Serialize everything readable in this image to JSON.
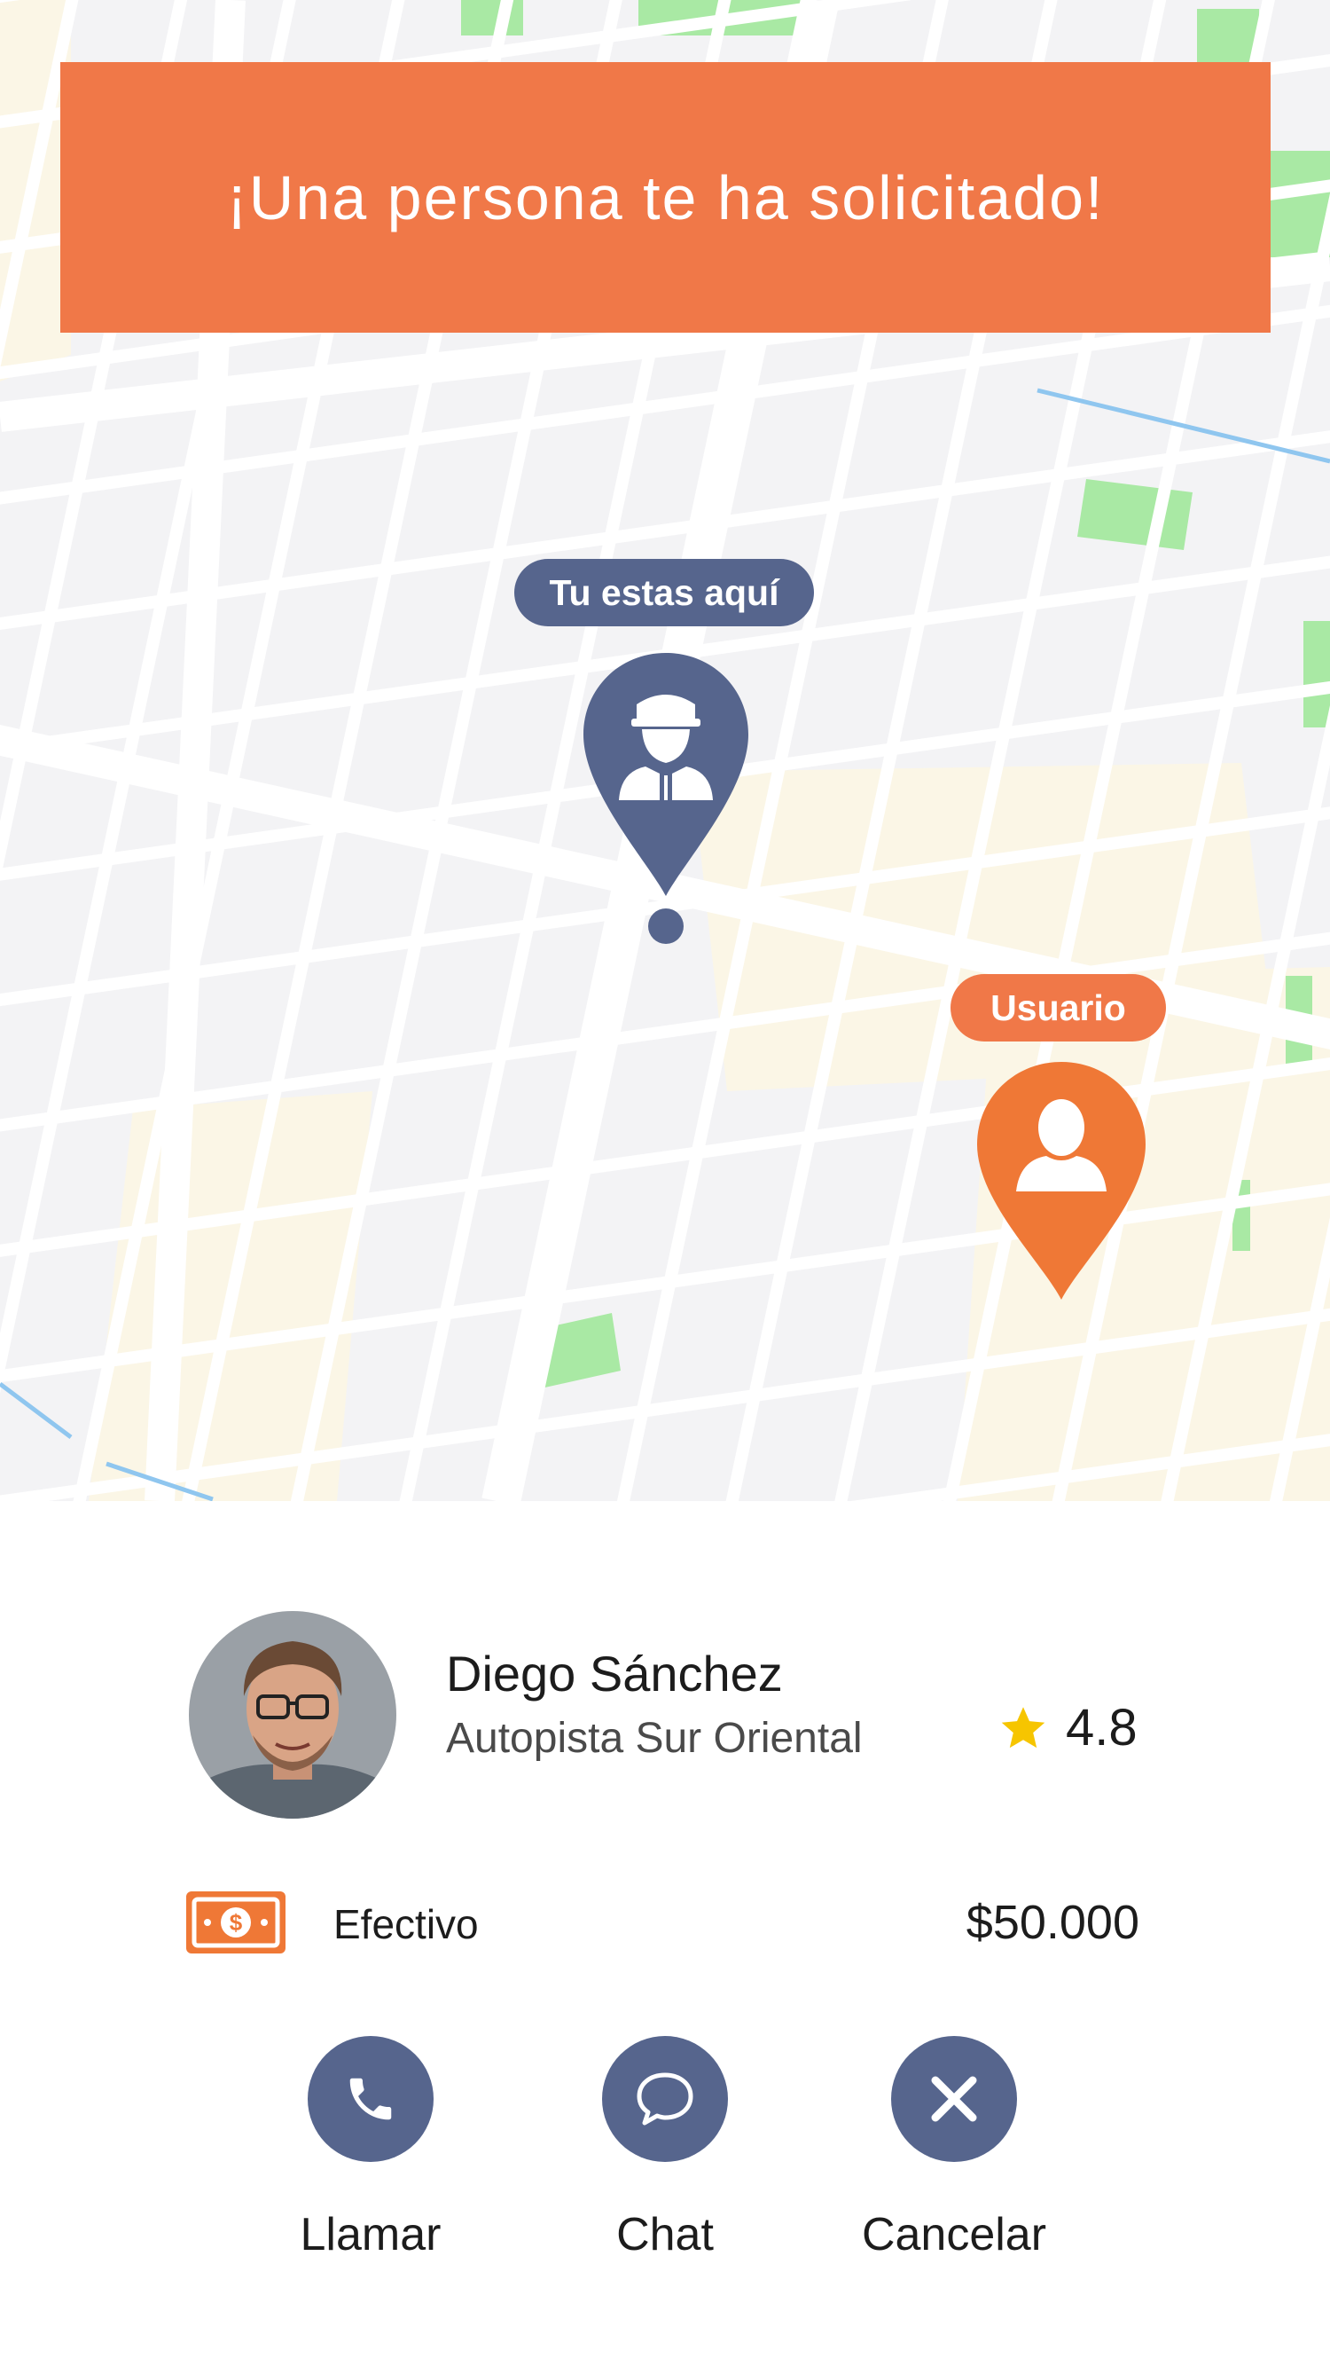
{
  "banner": {
    "text": "¡Una persona te ha solicitado!"
  },
  "map": {
    "driver_pin_label": "Tu estas aquí",
    "user_pin_label": "Usuario"
  },
  "passenger": {
    "name": "Diego Sánchez",
    "address": "Autopista Sur Oriental",
    "rating": "4.8"
  },
  "payment": {
    "method": "Efectivo",
    "amount": "$50.000"
  },
  "actions": [
    {
      "label": "Llamar",
      "icon": "phone-icon"
    },
    {
      "label": "Chat",
      "icon": "chat-bubble-icon"
    },
    {
      "label": "Cancelar",
      "icon": "close-icon"
    }
  ],
  "colors": {
    "accent_orange": "#f07848",
    "pin_orange": "#ef7836",
    "navy": "#56658d",
    "star": "#f6c500",
    "map_background": "#f3f3f5",
    "map_park": "#a9e9a4",
    "map_zone": "#fbf6e6"
  }
}
